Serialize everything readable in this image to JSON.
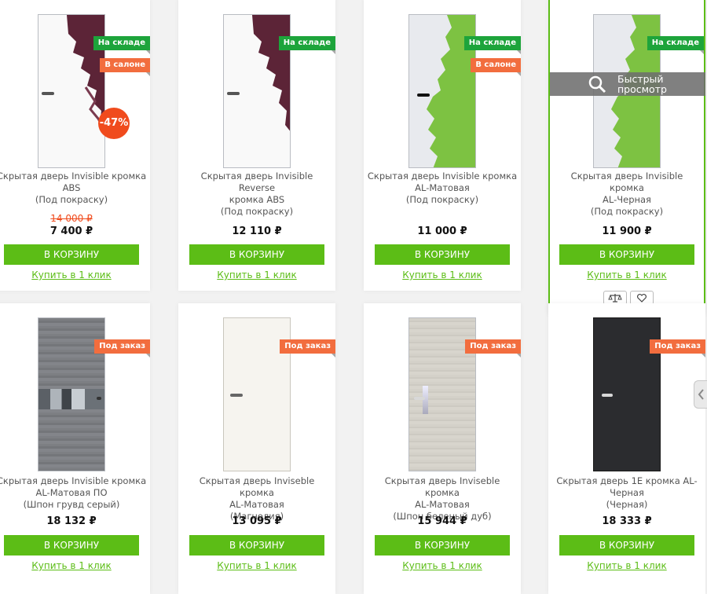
{
  "products": [
    {
      "title_lines": [
        "Скрытая дверь Invisible кромка",
        "ABS",
        "(Под покраску)"
      ],
      "badges": [
        "На складе",
        "В салоне"
      ],
      "discount": "-47%",
      "old_price": "14 000 ₽",
      "price": "7 400 ₽",
      "cart_label": "В КОРЗИНУ",
      "oneclick_label": "Купить в 1 клик",
      "door_style": "white-purple-paint"
    },
    {
      "title_lines": [
        "Скрытая дверь Invisible Reverse",
        "кромка ABS",
        "(Под покраску)"
      ],
      "badges": [
        "На складе"
      ],
      "price": "12 110 ₽",
      "cart_label": "В КОРЗИНУ",
      "oneclick_label": "Купить в 1 клик",
      "door_style": "white-purple-paint"
    },
    {
      "title_lines": [
        "Скрытая дверь Invisible кромка",
        "AL-Матовая",
        "(Под покраску)"
      ],
      "badges": [
        "На складе",
        "В салоне"
      ],
      "price": "11 000 ₽",
      "cart_label": "В КОРЗИНУ",
      "oneclick_label": "Купить в 1 клик",
      "door_style": "gray-green-paint"
    },
    {
      "title_lines": [
        "Скрытая дверь Invisible кромка",
        "AL-Черная",
        "(Под покраску)"
      ],
      "badges": [
        "На складе"
      ],
      "price": "11 900 ₽",
      "cart_label": "В КОРЗИНУ",
      "oneclick_label": "Купить в 1 клик",
      "quickview_label": "Быстрый просмотр",
      "door_style": "gray-green-paint"
    },
    {
      "title_lines": [
        "Скрытая дверь Invisible кромка",
        "AL-Матовая ПО",
        "(Шпон грувд серый)"
      ],
      "badges": [
        "Под заказ"
      ],
      "price": "18 132 ₽",
      "cart_label": "В КОРЗИНУ",
      "oneclick_label": "Купить в 1 клик",
      "door_style": "gray-veneer-glass"
    },
    {
      "title_lines": [
        "Скрытая дверь Inviseble кромка",
        "AL-Матовая",
        "(Магнолия)"
      ],
      "badges": [
        "Под заказ"
      ],
      "price": "13 095 ₽",
      "cart_label": "В КОРЗИНУ",
      "oneclick_label": "Купить в 1 клик",
      "door_style": "magnolia"
    },
    {
      "title_lines": [
        "Скрытая дверь Inviseble кромка",
        "AL-Матовая",
        "(Шпон беленый дуб)"
      ],
      "badges": [
        "Под заказ"
      ],
      "price": "15 944 ₽",
      "cart_label": "В КОРЗИНУ",
      "oneclick_label": "Купить в 1 клик",
      "door_style": "bleached-oak"
    },
    {
      "title_lines": [
        "Скрытая дверь 1E кромка AL-",
        "Черная",
        "(Черная)"
      ],
      "badges": [
        "Под заказ"
      ],
      "price": "18 333 ₽",
      "cart_label": "В КОРЗИНУ",
      "oneclick_label": "Купить в 1 клик",
      "door_style": "black"
    }
  ],
  "icons": {
    "quickview": "magnifier-icon",
    "compare": "scales-icon",
    "favorite": "heart-icon",
    "scroll": "chevron-left-icon"
  },
  "colors": {
    "accent": "#5cbd16",
    "in_stock": "#1da43b",
    "salon_order": "#f26d3e",
    "discount": "#f04b1d"
  }
}
